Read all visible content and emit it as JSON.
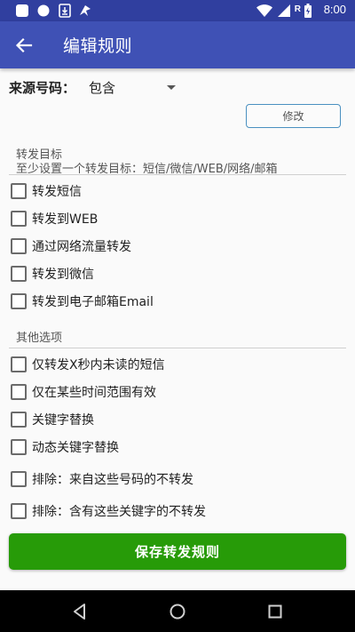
{
  "status_bar": {
    "time": "8:00",
    "signal_letter": "R",
    "icons": [
      "white-square-icon",
      "circle-icon",
      "download-box-icon",
      "bird-icon",
      "wifi-icon",
      "cellular-icon",
      "battery-icon"
    ]
  },
  "app_bar": {
    "title": "编辑规则",
    "back_icon": "arrow-back-icon"
  },
  "source": {
    "label": "来源号码：",
    "selected": "包含",
    "modify_label": "修改"
  },
  "forward_target": {
    "title": "转发目标",
    "hint": "至少设置一个转发目标：短信/微信/WEB/网络/邮箱",
    "items": [
      {
        "label": "转发短信",
        "checked": false
      },
      {
        "label": "转发到WEB",
        "checked": false
      },
      {
        "label": "通过网络流量转发",
        "checked": false
      },
      {
        "label": "转发到微信",
        "checked": false
      },
      {
        "label": "转发到电子邮箱Email",
        "checked": false
      }
    ]
  },
  "other_options": {
    "title": "其他选项",
    "items": [
      {
        "label": "仅转发X秒内未读的短信",
        "checked": false
      },
      {
        "label": "仅在某些时间范围有效",
        "checked": false
      },
      {
        "label": "关键字替换",
        "checked": false
      },
      {
        "label": "动态关键字替换",
        "checked": false
      },
      {
        "label": "排除：来自这些号码的不转发",
        "checked": false
      },
      {
        "label": "排除：含有这些关键字的不转发",
        "checked": false
      }
    ]
  },
  "save_label": "保存转发规则",
  "colors": {
    "status_bar": "#303f9f",
    "app_bar": "#3f51b5",
    "save_button": "#279b08",
    "modify_border": "#4a90c0"
  },
  "nav_bar": {
    "icons": [
      "nav-back-icon",
      "nav-home-icon",
      "nav-recents-icon"
    ]
  }
}
